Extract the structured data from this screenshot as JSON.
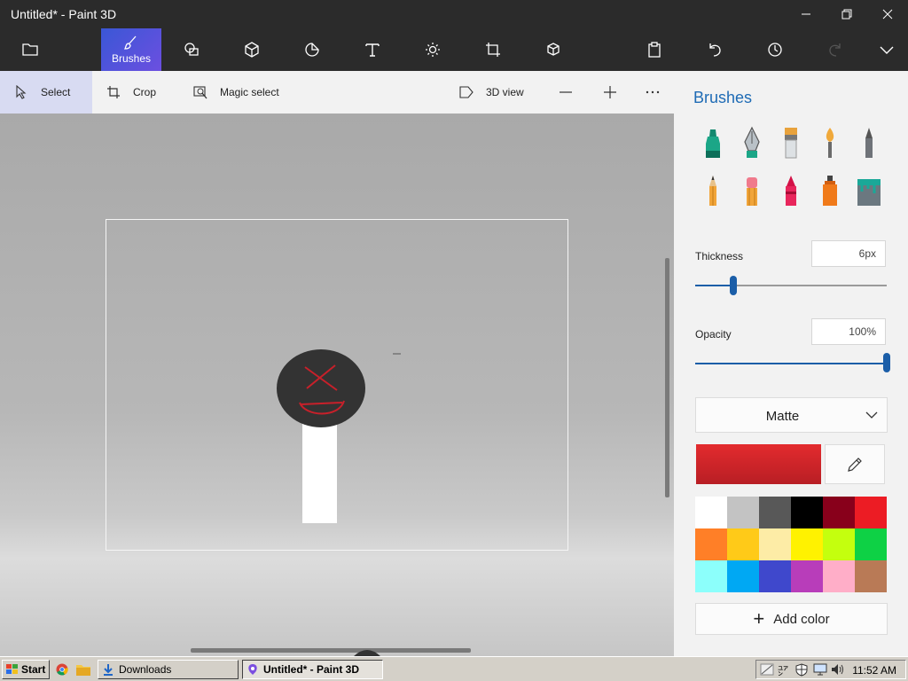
{
  "window": {
    "title": "Untitled* - Paint 3D"
  },
  "ribbon": {
    "active_tool_label": "Brushes",
    "icons": [
      "menu-folder-icon",
      "brushes-icon",
      "2d-shapes-icon",
      "3d-shapes-icon",
      "stickers-icon",
      "text-icon",
      "effects-icon",
      "canvas-icon",
      "3d-library-icon",
      "paste-icon",
      "undo-icon",
      "history-icon",
      "redo-icon",
      "expand-icon"
    ]
  },
  "toolbar": {
    "select_label": "Select",
    "crop_label": "Crop",
    "magic_select_label": "Magic select",
    "view3d_label": "3D view"
  },
  "panel": {
    "title": "Brushes",
    "brushes": [
      "marker",
      "calligraphy-pen",
      "oil-brush",
      "watercolor",
      "pixel-pen",
      "pencil",
      "eraser",
      "crayon",
      "spray-can",
      "fill"
    ],
    "thickness_label": "Thickness",
    "thickness_value": "6px",
    "thickness_level": 0.2,
    "opacity_label": "Opacity",
    "opacity_value": "100%",
    "opacity_level": 1.0,
    "finish": "Matte",
    "current_color": "#e32b2e",
    "palette": [
      "#ffffff",
      "#c3c3c3",
      "#585858",
      "#000000",
      "#88001b",
      "#ec1c24",
      "#ff7f27",
      "#ffca18",
      "#fdeca6",
      "#fff200",
      "#c4ff0e",
      "#0ed145",
      "#8cfffb",
      "#00a8f3",
      "#3f48cc",
      "#b83dba",
      "#ffaec8",
      "#b97a56"
    ],
    "add_color_label": "Add color"
  },
  "accent_color": "#1e6bb5",
  "taskbar": {
    "start_label": "Start",
    "downloads_label": "Downloads",
    "app_label": "Untitled* - Paint 3D",
    "clock": "11:52 AM"
  }
}
